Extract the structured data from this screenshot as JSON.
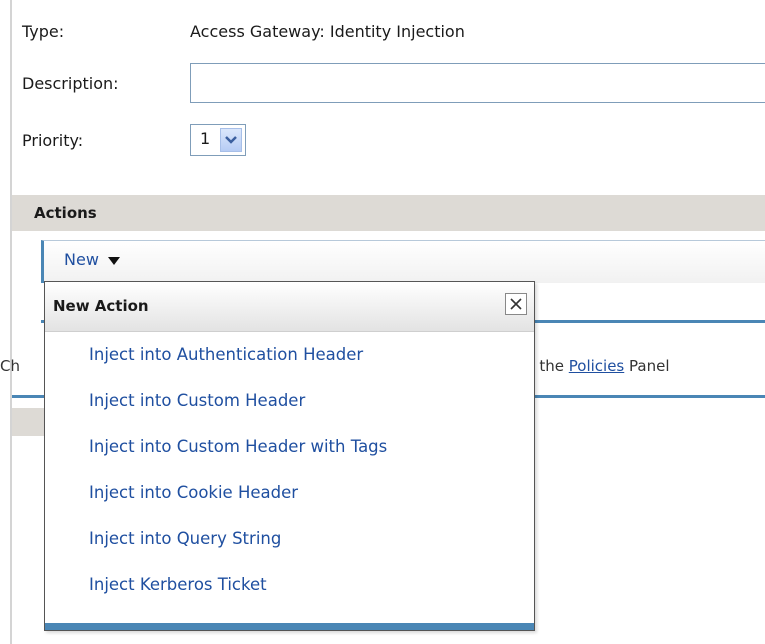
{
  "form": {
    "type_label": "Type:",
    "type_value": "Access Gateway: Identity Injection",
    "description_label": "Description:",
    "description_value": "",
    "priority_label": "Priority:",
    "priority_value": "1"
  },
  "actions": {
    "title": "Actions",
    "new_button_label": "New"
  },
  "hint": {
    "left_text": "Ch",
    "right_prefix": "m the ",
    "link_text": "Policies",
    "right_suffix": " Panel"
  },
  "dropdown": {
    "title": "New Action",
    "close_icon": "close-icon",
    "items": [
      "Inject into Authentication Header",
      "Inject into Custom Header",
      "Inject into Custom Header with Tags",
      "Inject into Cookie Header",
      "Inject into Query String",
      "Inject Kerberos Ticket"
    ]
  },
  "colors": {
    "link": "#1f4fa0",
    "accent_blue": "#4a86b5",
    "section_bar": "#dddad5"
  }
}
